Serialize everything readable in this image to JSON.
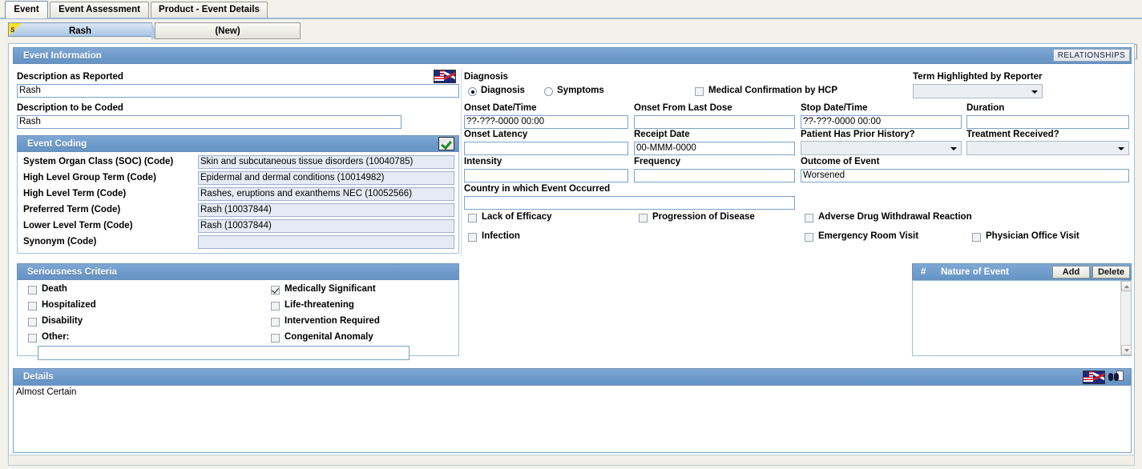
{
  "window": {
    "tabs": [
      {
        "label": "Event",
        "active": true
      },
      {
        "label": "Event Assessment",
        "active": false
      },
      {
        "label": "Product - Event Details",
        "active": false
      }
    ],
    "record_tabs": [
      {
        "label": "Rash",
        "selected": true,
        "marker": "S"
      },
      {
        "label": "(New)",
        "selected": false
      }
    ],
    "nav": {
      "prev_icon": "chevron-left-icon",
      "next_icon": "chevron-right-icon",
      "list_icon": "list-view-icon"
    }
  },
  "event_information": {
    "title": "Event Information",
    "relationships_button": "RELATIONSHIPS",
    "description_as_reported_label": "Description as Reported",
    "description_as_reported_value": "Rash",
    "description_to_be_coded_label": "Description to be Coded",
    "description_to_be_coded_value": "Rash",
    "language_flag_icon": "uk-us-flag-icon"
  },
  "diagnosis": {
    "group_label": "Diagnosis",
    "radio_diagnosis": {
      "label": "Diagnosis",
      "checked": true
    },
    "radio_symptoms": {
      "label": "Symptoms",
      "checked": false
    },
    "medical_confirmation": {
      "label": "Medical Confirmation by HCP",
      "checked": false
    },
    "term_highlighted_label": "Term Highlighted by Reporter",
    "term_highlighted_value": "",
    "onset_datetime_label": "Onset Date/Time",
    "onset_datetime_value": "??-???-0000 00:00",
    "onset_from_last_dose_label": "Onset From Last Dose",
    "onset_from_last_dose_value": "",
    "stop_datetime_label": "Stop Date/Time",
    "stop_datetime_value": "??-???-0000 00:00",
    "duration_label": "Duration",
    "duration_value": "",
    "onset_latency_label": "Onset Latency",
    "onset_latency_value": "",
    "receipt_date_label": "Receipt Date",
    "receipt_date_value": "00-MMM-0000",
    "prior_history_label": "Patient Has Prior History?",
    "prior_history_value": "",
    "treatment_received_label": "Treatment Received?",
    "treatment_received_value": "",
    "intensity_label": "Intensity",
    "intensity_value": "",
    "frequency_label": "Frequency",
    "frequency_value": "",
    "outcome_label": "Outcome of Event",
    "outcome_value": "Worsened",
    "country_label": "Country in which Event Occurred",
    "country_value": "",
    "flags": [
      {
        "label": "Lack of Efficacy",
        "checked": false
      },
      {
        "label": "Progression of Disease",
        "checked": false
      },
      {
        "label": "Adverse Drug Withdrawal Reaction",
        "checked": false
      },
      {
        "label": "Infection",
        "checked": false
      },
      {
        "label": "Emergency Room Visit",
        "checked": false
      },
      {
        "label": "Physician Office Visit",
        "checked": false
      }
    ]
  },
  "event_coding": {
    "title": "Event Coding",
    "autocode_icon": "green-check-icon",
    "rows": [
      {
        "label": "System Organ Class (SOC) (Code)",
        "value": "Skin and subcutaneous tissue disorders (10040785)"
      },
      {
        "label": "High Level Group Term (Code)",
        "value": "Epidermal and dermal conditions (10014982)"
      },
      {
        "label": "High Level Term (Code)",
        "value": "Rashes, eruptions and exanthems NEC (10052566)"
      },
      {
        "label": "Preferred Term (Code)",
        "value": "Rash (10037844)"
      },
      {
        "label": "Lower Level Term (Code)",
        "value": "Rash (10037844)"
      },
      {
        "label": "Synonym (Code)",
        "value": ""
      }
    ]
  },
  "seriousness": {
    "title": "Seriousness Criteria",
    "left": [
      {
        "label": "Death",
        "checked": false
      },
      {
        "label": "Hospitalized",
        "checked": false
      },
      {
        "label": "Disability",
        "checked": false
      },
      {
        "label": "Other:",
        "checked": false
      }
    ],
    "right": [
      {
        "label": "Medically Significant",
        "checked": true
      },
      {
        "label": "Life-threatening",
        "checked": false
      },
      {
        "label": "Intervention Required",
        "checked": false
      },
      {
        "label": "Congenital Anomaly",
        "checked": false
      }
    ],
    "other_value": ""
  },
  "nature_of_event": {
    "col_num": "#",
    "col_title": "Nature of Event",
    "add_button": "Add",
    "delete_button": "Delete",
    "rows": []
  },
  "details": {
    "title": "Details",
    "value": "Almost Certain",
    "flag_icon": "uk-us-flag-icon",
    "lookup_icon": "binoculars-icon"
  },
  "colors": {
    "panel_header": "#6f9bcb",
    "frame_border": "#9ec0e0",
    "field_border": "#7ba2c9",
    "readonly_bg": "#e6eaf4",
    "app_bg": "#f2f1ea",
    "marker_yellow": "#ffe22e"
  }
}
